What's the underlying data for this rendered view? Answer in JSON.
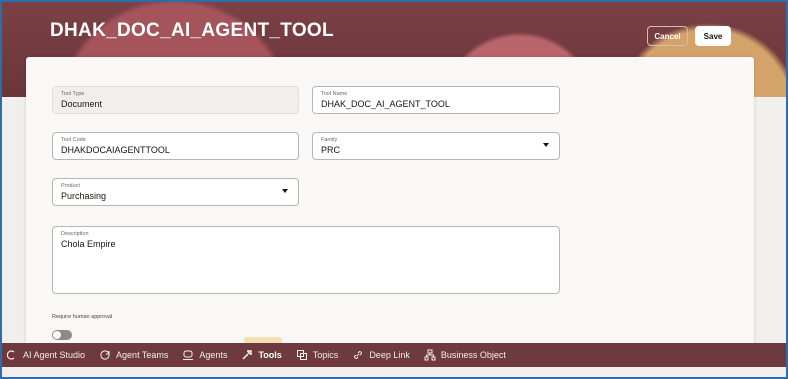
{
  "header": {
    "title": "DHAK_DOC_AI_AGENT_TOOL",
    "cancel_label": "Cancel",
    "save_label": "Save"
  },
  "form": {
    "tool_type": {
      "label": "Tool Type",
      "value": "Document"
    },
    "tool_name": {
      "label": "Tool Name",
      "value": "DHAK_DOC_AI_AGENT_TOOL"
    },
    "tool_code": {
      "label": "Tool Code",
      "value": "DHAKDOCAIAGENTTOOL"
    },
    "family": {
      "label": "Family",
      "value": "PRC"
    },
    "product": {
      "label": "Product",
      "value": "Purchasing"
    },
    "description": {
      "label": "Description",
      "value": "Chola Empire"
    },
    "require_human_approval": {
      "label": "Require human approval",
      "enabled": false
    }
  },
  "bottom_nav": {
    "items": [
      {
        "label": "AI Agent Studio",
        "icon": "studio-icon"
      },
      {
        "label": "Agent Teams",
        "icon": "agent-teams-icon"
      },
      {
        "label": "Agents",
        "icon": "agents-icon"
      },
      {
        "label": "Tools",
        "icon": "tools-icon",
        "active": true
      },
      {
        "label": "Topics",
        "icon": "topics-icon"
      },
      {
        "label": "Deep Link",
        "icon": "link-icon"
      },
      {
        "label": "Business Object",
        "icon": "business-object-icon"
      }
    ]
  },
  "colors": {
    "banner": "#6f3a3e",
    "nav": "#6f3a3e",
    "frame_border": "#2e6da8",
    "card": "#f9f8f6"
  }
}
